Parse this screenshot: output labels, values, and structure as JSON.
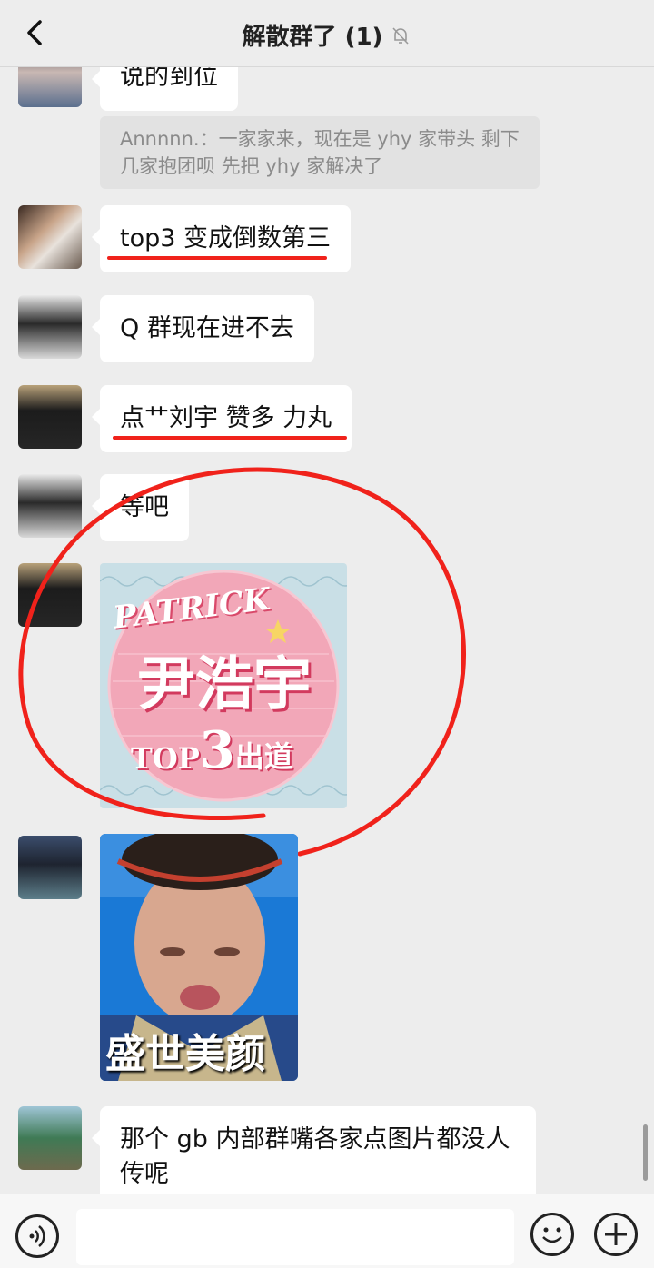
{
  "header": {
    "title": "解散群了 (1)",
    "back_icon": "back-chevron-icon",
    "mute_icon": "bell-muted-icon"
  },
  "messages": [
    {
      "text": "说的到位"
    },
    {
      "quote": "Annnnn.：一家家来，现在是 yhy 家带头 剩下几家抱团呗 先把 yhy 家解决了"
    },
    {
      "text": "top3 变成倒数第三"
    },
    {
      "text": "Q 群现在进不去"
    },
    {
      "text": "点艹刘宇 赞多 力丸"
    },
    {
      "text": "等吧"
    },
    {
      "sticker": {
        "line1": "PATRICK",
        "line2": "尹浩宇",
        "line3a": "TOP",
        "line3b": "3",
        "line3c": "出道"
      }
    },
    {
      "photo": {
        "caption": "盛世美颜"
      }
    },
    {
      "text": "那个 gb 内部群嘴各家点图片都没人传呢"
    }
  ],
  "input": {
    "placeholder": ""
  },
  "colors": {
    "annotation_red": "#f0221b",
    "bubble": "#ffffff",
    "background": "#ededed",
    "quote_bg": "#e2e2e2"
  }
}
